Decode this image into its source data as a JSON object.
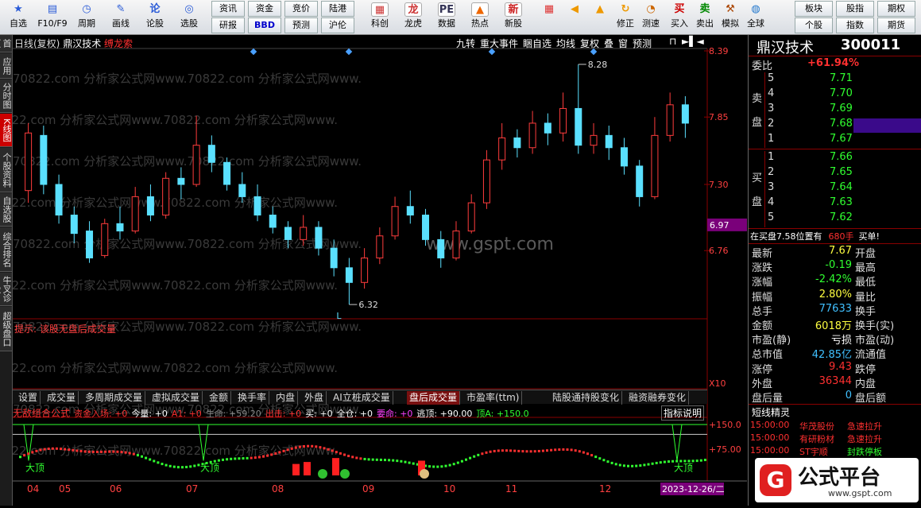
{
  "toolbar": {
    "left_items": [
      {
        "icon": "star-icon",
        "label": "自选"
      },
      {
        "icon": "f10-icon",
        "label": "F10/F9"
      },
      {
        "icon": "clock-icon",
        "label": "周期"
      },
      {
        "icon": "pen-icon",
        "label": "画线"
      },
      {
        "icon": "lun-icon",
        "label": "论股"
      },
      {
        "icon": "pick-icon",
        "label": "选股"
      }
    ],
    "grid_buttons": [
      "资讯",
      "资金",
      "竞价",
      "陆港",
      "研报",
      "BBD",
      "预测",
      "沪伦"
    ],
    "mid_items": [
      {
        "icon": "chart-icon",
        "label": "科创"
      },
      {
        "icon": "dragon-icon",
        "label": "龙虎"
      },
      {
        "icon": "pe-icon",
        "label": "数据"
      },
      {
        "icon": "hot-icon",
        "label": "热点"
      },
      {
        "icon": "new-icon",
        "label": "新股"
      }
    ],
    "right_items": [
      {
        "icon": "grid-icon",
        "label": ""
      },
      {
        "icon": "back-arrow-icon",
        "label": ""
      },
      {
        "icon": "up-down-icon",
        "label": ""
      },
      {
        "icon": "refresh-icon",
        "label": "修正"
      },
      {
        "icon": "timer-icon",
        "label": "测速"
      },
      {
        "icon": "buy-icon",
        "label": "买入"
      },
      {
        "icon": "sell-icon",
        "label": "卖出"
      },
      {
        "icon": "hammer-icon",
        "label": "模拟"
      },
      {
        "icon": "globe-icon",
        "label": "全球"
      }
    ],
    "corner_buttons": [
      "板块",
      "股指",
      "期权",
      "个股",
      "指数",
      "期货"
    ]
  },
  "leftbar": [
    "首页",
    "应用",
    "分时图",
    "K线图",
    "个股资料",
    "自选股",
    "综合排名",
    "牛叉诊股",
    "超级盘口"
  ],
  "chart": {
    "title": "日线(复权)",
    "stock": "鼎汉技术",
    "indicator": "缚龙索",
    "header_buttons": [
      "九转",
      "重大事件",
      "睏自选",
      "均线",
      "复权",
      "叠",
      "窗",
      "预测"
    ],
    "price_axis": [
      "8.39",
      "7.85",
      "7.30",
      "6.76"
    ],
    "current_price_tag": "6.97",
    "high_label": "8.28",
    "low_label": "6.32",
    "low_marker": "L",
    "hint": "提示: 该股无盘后成交量",
    "sub_axis": "X10",
    "watermark": "70822.com 分析家公式网www.70822.com 分析家公式网www.",
    "center_watermark": "www.gspt.com",
    "candles": [
      [
        7.25,
        7.72,
        7.15,
        7.8
      ],
      [
        7.7,
        7.3,
        7.22,
        7.78
      ],
      [
        7.3,
        7.05,
        6.98,
        7.38
      ],
      [
        7.05,
        6.9,
        6.82,
        7.12
      ],
      [
        6.92,
        6.7,
        6.66,
        7.0
      ],
      [
        6.72,
        6.98,
        6.7,
        7.02
      ],
      [
        6.98,
        6.92,
        6.85,
        7.12
      ],
      [
        6.92,
        7.2,
        6.9,
        7.28
      ],
      [
        7.2,
        7.05,
        7.0,
        7.3
      ],
      [
        7.05,
        7.35,
        7.02,
        7.4
      ],
      [
        7.35,
        7.3,
        7.18,
        7.44
      ],
      [
        7.3,
        7.62,
        7.28,
        7.86
      ],
      [
        7.62,
        7.48,
        7.4,
        7.7
      ],
      [
        7.48,
        7.3,
        7.25,
        7.52
      ],
      [
        7.3,
        7.2,
        7.15,
        7.4
      ],
      [
        7.2,
        7.05,
        7.0,
        7.3
      ],
      [
        7.05,
        6.95,
        6.9,
        7.12
      ],
      [
        6.95,
        6.85,
        6.78,
        7.0
      ],
      [
        6.85,
        6.95,
        6.8,
        7.05
      ],
      [
        6.95,
        6.78,
        6.72,
        7.0
      ],
      [
        6.78,
        6.62,
        6.55,
        6.85
      ],
      [
        6.62,
        6.5,
        6.32,
        6.7
      ],
      [
        6.5,
        6.7,
        6.45,
        6.78
      ],
      [
        6.7,
        6.88,
        6.65,
        6.95
      ],
      [
        6.88,
        7.12,
        6.85,
        7.2
      ],
      [
        7.12,
        7.05,
        6.98,
        7.25
      ],
      [
        7.05,
        6.85,
        6.8,
        7.1
      ],
      [
        6.85,
        6.7,
        6.62,
        6.92
      ],
      [
        6.7,
        6.92,
        6.68,
        7.0
      ],
      [
        6.92,
        7.15,
        6.9,
        7.22
      ],
      [
        7.15,
        7.5,
        7.1,
        7.58
      ],
      [
        7.5,
        7.68,
        7.42,
        7.8
      ],
      [
        7.68,
        7.6,
        7.52,
        7.75
      ],
      [
        7.6,
        7.8,
        7.55,
        7.9
      ],
      [
        7.8,
        7.72,
        7.62,
        7.88
      ],
      [
        7.72,
        7.92,
        7.65,
        8.05
      ],
      [
        7.92,
        7.62,
        7.55,
        8.28
      ],
      [
        7.62,
        7.7,
        7.55,
        7.8
      ],
      [
        7.7,
        7.6,
        7.5,
        7.78
      ],
      [
        7.6,
        7.45,
        7.38,
        7.68
      ],
      [
        7.45,
        7.2,
        7.12,
        7.5
      ],
      [
        7.2,
        7.7,
        7.18,
        7.85
      ],
      [
        7.7,
        7.95,
        7.65,
        8.05
      ],
      [
        7.95,
        7.8,
        7.68,
        8.02
      ]
    ],
    "x_labels": [
      "04",
      "05",
      "06",
      "07",
      "08",
      "09",
      "10",
      "11",
      "12"
    ],
    "date_tag": "2023-12-26/二"
  },
  "tabs": [
    "设置",
    "成交量",
    "多周期成交量",
    "虚拟成交量",
    "金额",
    "换手率",
    "内盘",
    "外盘",
    "AI立桩成交量",
    "盘后成交量",
    "市盈率(ttm)",
    "陆股通持股变化",
    "融资融券变化"
  ],
  "active_tab": "盘后成交量",
  "indicator_bar": {
    "name": "无敌组合公式",
    "items": [
      {
        "text": "资金入场: +0",
        "color": "#ff3030"
      },
      {
        "text": "今量: +0",
        "color": "#ffffff"
      },
      {
        "text": "A1: +0",
        "color": "#ff3030"
      },
      {
        "text": "生命: +59.20",
        "color": "#888888"
      },
      {
        "text": "出击: +0",
        "color": "#ff3030"
      },
      {
        "text": "买: +0",
        "color": "#ffffff"
      },
      {
        "text": "全仓: +0",
        "color": "#ffffff"
      },
      {
        "text": "要命: +0",
        "color": "#ff40ff"
      },
      {
        "text": "逃顶: +90.00",
        "color": "#ffffff"
      },
      {
        "text": "顶A: +150.0",
        "color": "#30ff30"
      }
    ],
    "button": "指标说明"
  },
  "sub_axis_labels": [
    "+150.0",
    "+75.00"
  ],
  "top_marks": [
    "大顶",
    "大顶",
    "大顶"
  ],
  "info": {
    "name": "鼎汉技术",
    "code": "300011",
    "weibi_label": "委比",
    "weibi": "+61.94%",
    "sell_label": "卖盘",
    "buy_label": "买盘",
    "sells": [
      [
        "5",
        "7.71"
      ],
      [
        "4",
        "7.70"
      ],
      [
        "3",
        "7.69"
      ],
      [
        "2",
        "7.68"
      ],
      [
        "1",
        "7.67"
      ]
    ],
    "buys": [
      [
        "1",
        "7.66"
      ],
      [
        "2",
        "7.65"
      ],
      [
        "3",
        "7.64"
      ],
      [
        "4",
        "7.63"
      ],
      [
        "5",
        "7.62"
      ]
    ],
    "inbuy": "在买盘7.58位置有",
    "inbuy_qty": "680手",
    "inbuy_suffix": "买单!",
    "stats": [
      [
        "最新",
        "7.67",
        "开盘"
      ],
      [
        "涨跌",
        "-0.19",
        "最高"
      ],
      [
        "涨幅",
        "-2.42%",
        "最低"
      ],
      [
        "振幅",
        "2.80%",
        "量比"
      ],
      [
        "总手",
        "77633",
        "换手"
      ],
      [
        "金额",
        "6018万",
        "换手(实)"
      ],
      [
        "市盈(静)",
        "亏损",
        "市盈(动)"
      ],
      [
        "总市值",
        "42.85亿",
        "流通值"
      ],
      [
        "涨停",
        "9.43",
        "跌停"
      ],
      [
        "外盘",
        "36344",
        "内盘"
      ],
      [
        "盘后量",
        "0",
        "盘后额"
      ]
    ],
    "stat_colors": [
      "#ffff40",
      "#30ff30",
      "#30ff30",
      "#ffff40",
      "#40c0ff",
      "#ffff40",
      "#ffffff",
      "#40c0ff",
      "#ff3030",
      "#ff3030",
      "#40c0ff"
    ],
    "news_title": "短线精灵",
    "news": [
      [
        "15:00:00",
        "华茂股份",
        "急速拉升"
      ],
      [
        "15:00:00",
        "有研粉材",
        "急速拉升"
      ],
      [
        "15:00:00",
        "ST宇顺",
        "封跌停板"
      ]
    ],
    "logo_text": "公式平台",
    "logo_url": "www.gspt.com"
  }
}
